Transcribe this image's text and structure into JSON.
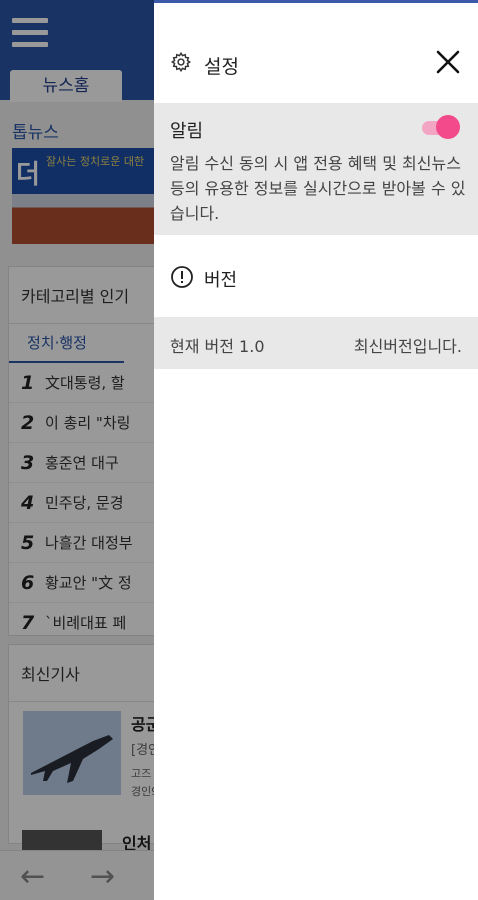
{
  "background_app": {
    "tab_home": "뉴스홈",
    "top_news_label": "톱뉴스",
    "banner_logo": "더",
    "banner_text": "잘사는 정치로운 대한",
    "category_card_title": "카테고리별 인기",
    "category_tab": "정치·행정",
    "ranking": [
      {
        "num": "1",
        "text": "文대통령, 할"
      },
      {
        "num": "2",
        "text": "이 총리 \"차링"
      },
      {
        "num": "3",
        "text": "홍준연 대구"
      },
      {
        "num": "4",
        "text": "민주당, 문경"
      },
      {
        "num": "5",
        "text": "나흘간 대정부"
      },
      {
        "num": "6",
        "text": "황교안 \"文 정"
      },
      {
        "num": "7",
        "text": "`비례대표 페"
      }
    ],
    "latest_title": "최신기사",
    "latest_headline": "공군",
    "latest_sub": "[경인",
    "latest_sub2": "고즈",
    "latest_sub3": "경인9",
    "latest_headline2": "인처",
    "nav_back": "←",
    "nav_forward": "→"
  },
  "drawer": {
    "title": "설정",
    "icons": {
      "settings": "gear-icon",
      "close": "close-icon",
      "info": "info-icon"
    },
    "alarm": {
      "label": "알림",
      "toggle_on": true,
      "description": "알림 수신 동의 시 앱 전용 혜택 및 최신뉴스 등의 유용한 정보를 실시간으로 받아볼 수 있습니다."
    },
    "version": {
      "label": "버전",
      "current": "현재 버전 1.0",
      "status": "최신버전입니다."
    }
  },
  "colors": {
    "accent": "#2a55a8",
    "toggle_knob": "#f24a8a",
    "toggle_track": "#f3a6c3",
    "section_bg": "#e8e8e8"
  }
}
